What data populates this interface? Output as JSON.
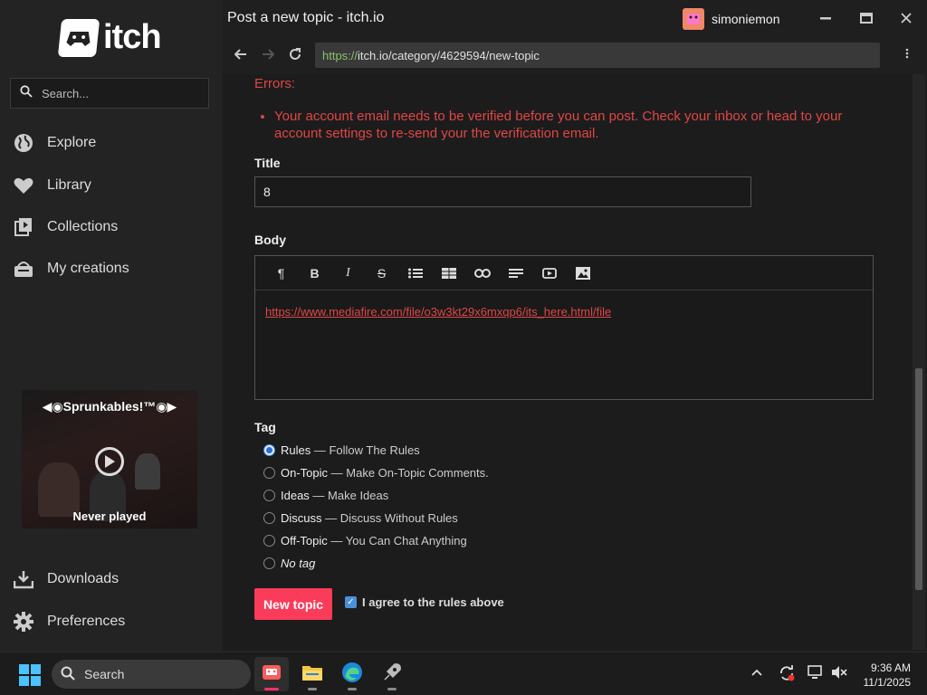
{
  "window": {
    "title": "Post a new topic - itch.io",
    "username": "simoniemon",
    "url_protocol": "https://",
    "url_rest": "itch.io/category/4629594/new-topic"
  },
  "sidebar": {
    "logo_text": "itch",
    "search_placeholder": "Search...",
    "items": [
      {
        "label": "Explore",
        "icon": "globe-icon"
      },
      {
        "label": "Library",
        "icon": "heart-icon"
      },
      {
        "label": "Collections",
        "icon": "collections-icon"
      },
      {
        "label": "My creations",
        "icon": "basket-icon"
      }
    ],
    "game": {
      "title": "◀◉Sprunkables!™◉▶",
      "status": "Never played"
    },
    "bottom_items": [
      {
        "label": "Downloads",
        "icon": "download-icon"
      },
      {
        "label": "Preferences",
        "icon": "gear-icon"
      }
    ]
  },
  "form": {
    "errors_title": "Errors:",
    "errors": [
      "Your account email needs to be verified before you can post. Check your inbox or head to your account settings to re-send your the verification email."
    ],
    "title_label": "Title",
    "title_value": "8",
    "body_label": "Body",
    "body_link": "https://www.mediafire.com/file/o3w3kt29x6mxqp6/its_here.html/file",
    "tag_label": "Tag",
    "tags": [
      {
        "name": "Rules",
        "desc": "Follow The Rules",
        "checked": true
      },
      {
        "name": "On-Topic",
        "desc": "Make On-Topic Comments.",
        "checked": false
      },
      {
        "name": "Ideas",
        "desc": "Make Ideas",
        "checked": false
      },
      {
        "name": "Discuss",
        "desc": "Discuss Without Rules",
        "checked": false
      },
      {
        "name": "Off-Topic",
        "desc": "You Can Chat Anything",
        "checked": false
      },
      {
        "name": "No tag",
        "desc": "",
        "checked": false
      }
    ],
    "separator": " — ",
    "submit_label": "New topic",
    "agree_label": "I agree to the rules above",
    "agree_checked": true
  },
  "taskbar": {
    "search_label": "Search",
    "time": "9:36 AM",
    "date": "11/1/2025"
  },
  "colors": {
    "accent": "#fa3c5a",
    "error": "#e04646",
    "url_protocol": "#8bc26a"
  }
}
